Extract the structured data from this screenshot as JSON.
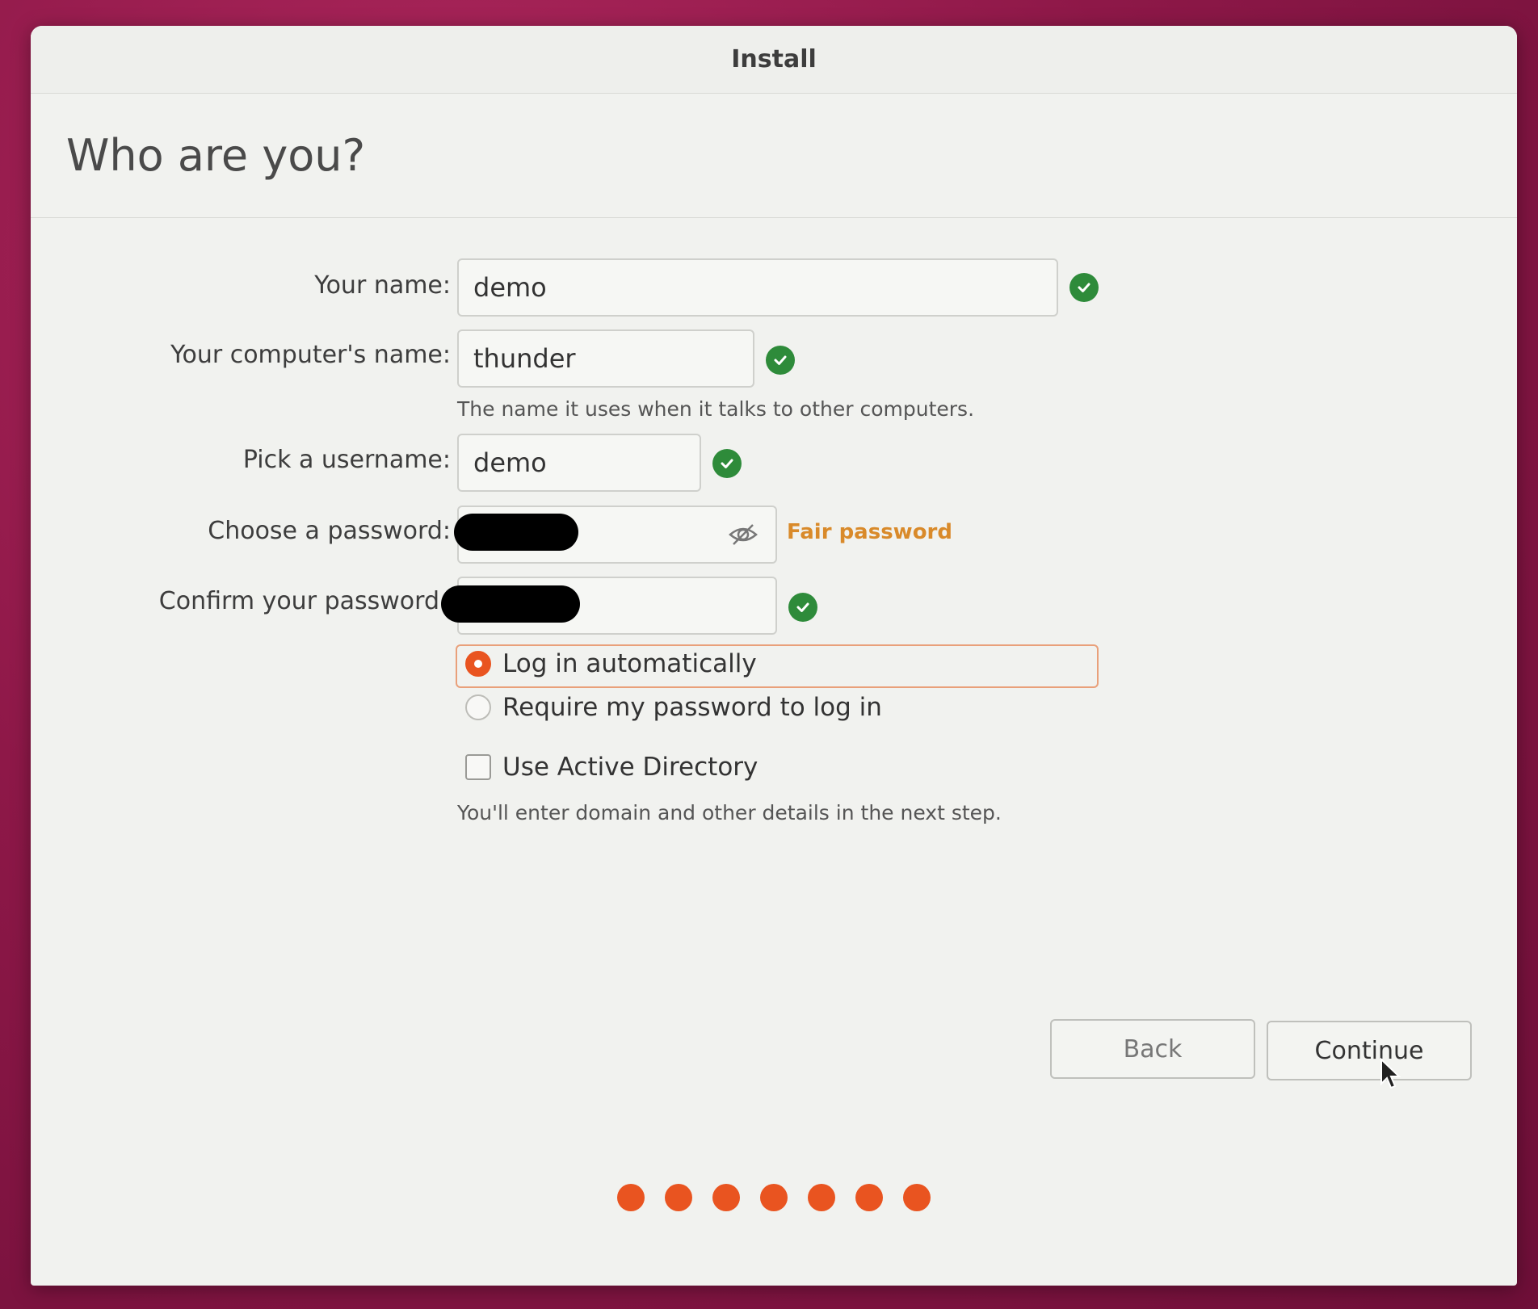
{
  "window": {
    "title": "Install"
  },
  "page": {
    "heading": "Who are you?"
  },
  "form": {
    "name_label": "Your name:",
    "name_value": "demo",
    "computer_label": "Your computer's name:",
    "computer_value": "thunder",
    "computer_hint": "The name it uses when it talks to other computers.",
    "username_label": "Pick a username:",
    "username_value": "demo",
    "password_label": "Choose a password:",
    "password_strength": "Fair password",
    "confirm_label": "Confirm your password",
    "login_auto_label": "Log in automatically",
    "login_require_label": "Require my password to log in",
    "login_selected": "Log in automatically",
    "active_directory_label": "Use Active Directory",
    "active_directory_checked": false,
    "active_directory_hint": "You'll enter domain and other details in the next step."
  },
  "buttons": {
    "back": "Back",
    "continue": "Continue"
  },
  "progress": {
    "steps_total": 7,
    "steps_completed": 7
  },
  "colors": {
    "accent": "#e95420",
    "valid": "#2e8b3a",
    "strength_fair": "#d98a2a"
  },
  "icons": {
    "valid": "check-circle-icon",
    "reveal": "eye-slash-icon",
    "pointer": "mouse-pointer-icon"
  }
}
